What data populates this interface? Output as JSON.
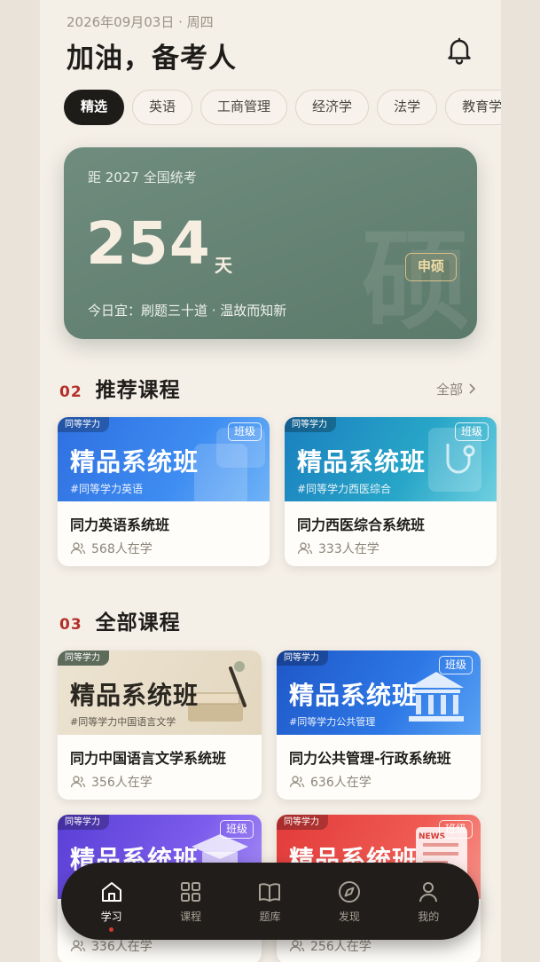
{
  "header": {
    "date": "2026年09月03日 · 周四",
    "greeting": "加油，备考人"
  },
  "tabs": [
    "精选",
    "英语",
    "工商管理",
    "经济学",
    "法学",
    "教育学"
  ],
  "countdown": {
    "label": "距 2027 全国统考",
    "days": "254",
    "unit": "天",
    "tip": "今日宜：刷题三十道 · 温故而知新",
    "badge": "申硕",
    "watermark": "硕"
  },
  "recommended": {
    "num": "02",
    "title": "推荐课程",
    "more": "全部",
    "courses": [
      {
        "pill": "同等学力",
        "banner_title": "精品系统班",
        "banner_sub": "#同等学力英语",
        "tag": "班级",
        "name": "同力英语系统班",
        "learners": "568人在学"
      },
      {
        "pill": "同等学力",
        "banner_title": "精品系统班",
        "banner_sub": "#同等学力西医综合",
        "tag": "班级",
        "name": "同力西医综合系统班",
        "learners": "333人在学"
      }
    ]
  },
  "all_courses": {
    "num": "03",
    "title": "全部课程",
    "courses": [
      {
        "pill": "同等学力",
        "banner_title": "精品系统班",
        "banner_sub": "#同等学力中国语言文学",
        "name": "同力中国语言文学系统班",
        "learners": "356人在学"
      },
      {
        "pill": "同等学力",
        "banner_title": "精品系统班",
        "banner_sub": "#同等学力公共管理",
        "tag": "班级",
        "name": "同力公共管理-行政系统班",
        "learners": "636人在学"
      },
      {
        "pill": "同等学力",
        "banner_title": "精品系统班",
        "tag": "班级",
        "learners": "336人在学"
      },
      {
        "pill": "同等学力",
        "banner_title": "精品系统班",
        "tag": "班级",
        "news": "NEWS",
        "learners": "256人在学"
      }
    ]
  },
  "tabbar": [
    {
      "label": "学习",
      "icon": "home-icon",
      "active": true
    },
    {
      "label": "课程",
      "icon": "grid-icon"
    },
    {
      "label": "题库",
      "icon": "book-icon"
    },
    {
      "label": "发现",
      "icon": "compass-icon"
    },
    {
      "label": "我的",
      "icon": "user-icon"
    }
  ],
  "colors": {
    "accent": "#b5302a",
    "countdown_bg": "#5f7d6e",
    "tabbar_bg": "#201d1a"
  }
}
